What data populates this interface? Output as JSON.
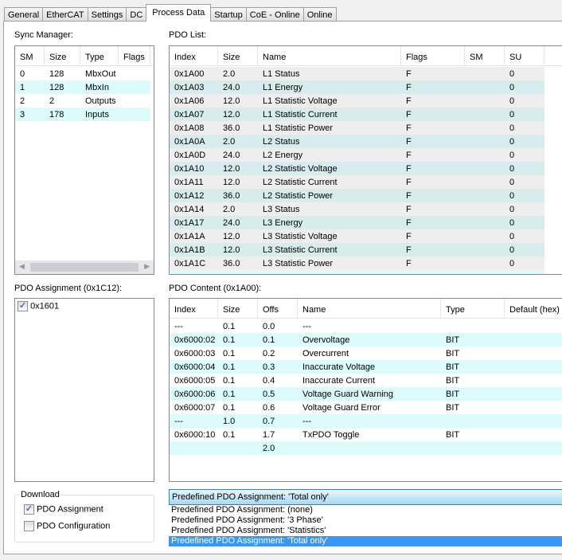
{
  "tabs": [
    "General",
    "EtherCAT",
    "Settings",
    "DC",
    "Process Data",
    "Startup",
    "CoE - Online",
    "Online"
  ],
  "active_tab": "Process Data",
  "sync_manager": {
    "label": "Sync Manager:",
    "columns": [
      "SM",
      "Size",
      "Type",
      "Flags"
    ],
    "rows": [
      [
        "0",
        "128",
        "MbxOut",
        ""
      ],
      [
        "1",
        "128",
        "MbxIn",
        ""
      ],
      [
        "2",
        "2",
        "Outputs",
        ""
      ],
      [
        "3",
        "178",
        "Inputs",
        ""
      ]
    ]
  },
  "pdo_list": {
    "label": "PDO List:",
    "columns": [
      "Index",
      "Size",
      "Name",
      "Flags",
      "SM",
      "SU"
    ],
    "rows": [
      [
        "0x1A00",
        "2.0",
        "L1 Status",
        "F",
        "",
        "0"
      ],
      [
        "0x1A03",
        "24.0",
        "L1 Energy",
        "F",
        "",
        "0"
      ],
      [
        "0x1A06",
        "12.0",
        "L1 Statistic Voltage",
        "F",
        "",
        "0"
      ],
      [
        "0x1A07",
        "12.0",
        "L1 Statistic Current",
        "F",
        "",
        "0"
      ],
      [
        "0x1A08",
        "36.0",
        "L1 Statistic Power",
        "F",
        "",
        "0"
      ],
      [
        "0x1A0A",
        "2.0",
        "L2 Status",
        "F",
        "",
        "0"
      ],
      [
        "0x1A0D",
        "24.0",
        "L2 Energy",
        "F",
        "",
        "0"
      ],
      [
        "0x1A10",
        "12.0",
        "L2 Statistic Voltage",
        "F",
        "",
        "0"
      ],
      [
        "0x1A11",
        "12.0",
        "L2 Statistic Current",
        "F",
        "",
        "0"
      ],
      [
        "0x1A12",
        "36.0",
        "L2 Statistic Power",
        "F",
        "",
        "0"
      ],
      [
        "0x1A14",
        "2.0",
        "L3 Status",
        "F",
        "",
        "0"
      ],
      [
        "0x1A17",
        "24.0",
        "L3 Energy",
        "F",
        "",
        "0"
      ],
      [
        "0x1A1A",
        "12.0",
        "L3 Statistic Voltage",
        "F",
        "",
        "0"
      ],
      [
        "0x1A1B",
        "12.0",
        "L3 Statistic Current",
        "F",
        "",
        "0"
      ],
      [
        "0x1A1C",
        "36.0",
        "L3 Statistic Power",
        "F",
        "",
        "0"
      ]
    ]
  },
  "pdo_assignment": {
    "label": "PDO Assignment (0x1C12):",
    "items": [
      {
        "label": "0x1601",
        "checked": true
      }
    ]
  },
  "pdo_content": {
    "label": "PDO Content (0x1A00):",
    "columns": [
      "Index",
      "Size",
      "Offs",
      "Name",
      "Type",
      "Default (hex)"
    ],
    "rows": [
      [
        "---",
        "0.1",
        "0.0",
        "---",
        "",
        ""
      ],
      [
        "0x6000:02",
        "0.1",
        "0.1",
        "Overvoltage",
        "BIT",
        ""
      ],
      [
        "0x6000:03",
        "0.1",
        "0.2",
        "Overcurrent",
        "BIT",
        ""
      ],
      [
        "0x6000:04",
        "0.1",
        "0.3",
        "Inaccurate Voltage",
        "BIT",
        ""
      ],
      [
        "0x6000:05",
        "0.1",
        "0.4",
        "Inaccurate Current",
        "BIT",
        ""
      ],
      [
        "0x6000:06",
        "0.1",
        "0.5",
        "Voltage Guard Warning",
        "BIT",
        ""
      ],
      [
        "0x6000:07",
        "0.1",
        "0.6",
        "Voltage Guard Error",
        "BIT",
        ""
      ],
      [
        "---",
        "1.0",
        "0.7",
        "---",
        "",
        ""
      ],
      [
        "0x6000:10",
        "0.1",
        "1.7",
        "TxPDO Toggle",
        "BIT",
        ""
      ],
      [
        "",
        "",
        "2.0",
        "",
        "",
        ""
      ]
    ]
  },
  "download": {
    "label": "Download",
    "pdo_assignment": {
      "label": "PDO Assignment",
      "checked": true
    },
    "pdo_configuration": {
      "label": "PDO Configuration",
      "checked": false
    }
  },
  "predefined": {
    "selected": "Predefined PDO Assignment: 'Total only'",
    "options": [
      "Predefined PDO Assignment: (none)",
      "Predefined PDO Assignment: '3 Phase'",
      "Predefined PDO Assignment: 'Statistics'",
      "Predefined PDO Assignment: 'Total only'"
    ]
  },
  "colors": {
    "row_cyan": "#dcfcfc",
    "row_grey": "#eeeeee",
    "row_cyan_disabled": "#d6eced",
    "selected": "#3399ff"
  }
}
